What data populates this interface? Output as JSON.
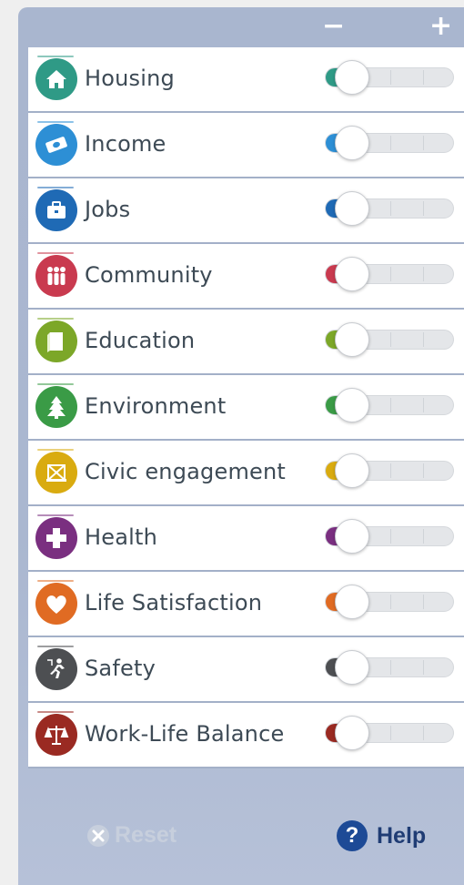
{
  "zoom": {
    "minus_label": "−",
    "plus_label": "+"
  },
  "topics": [
    {
      "label": "Housing",
      "icon": "house-icon",
      "color": "#2f9a86",
      "level": 0
    },
    {
      "label": "Income",
      "icon": "money-icon",
      "color": "#2d8fd5",
      "level": 0
    },
    {
      "label": "Jobs",
      "icon": "briefcase-icon",
      "color": "#1f6ab5",
      "level": 0
    },
    {
      "label": "Community",
      "icon": "people-icon",
      "color": "#c93a4f",
      "level": 0
    },
    {
      "label": "Education",
      "icon": "book-icon",
      "color": "#7ca728",
      "level": 0
    },
    {
      "label": "Environment",
      "icon": "tree-icon",
      "color": "#3a9b46",
      "level": 0
    },
    {
      "label": "Civic engagement",
      "icon": "ballot-icon",
      "color": "#d9ab10",
      "level": 0
    },
    {
      "label": "Health",
      "icon": "cross-icon",
      "color": "#7a2f80",
      "level": 0
    },
    {
      "label": "Life Satisfaction",
      "icon": "heart-icon",
      "color": "#e06b23",
      "level": 0
    },
    {
      "label": "Safety",
      "icon": "runner-icon",
      "color": "#4d4f52",
      "level": 0
    },
    {
      "label": "Work-Life Balance",
      "icon": "scale-icon",
      "color": "#9a2a22",
      "level": 0
    }
  ],
  "footer": {
    "reset_label": "Reset",
    "help_label": "Help",
    "help_glyph": "?"
  }
}
